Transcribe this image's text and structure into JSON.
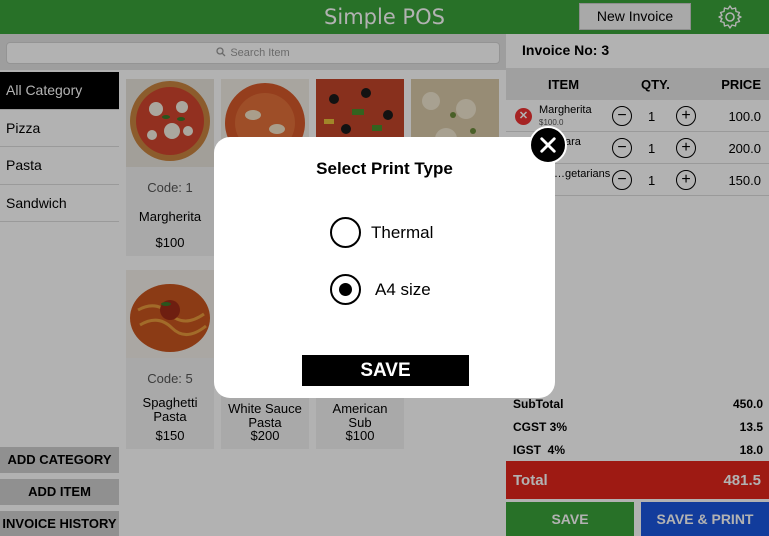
{
  "header": {
    "app_title": "Simple POS",
    "new_invoice_label": "New Invoice",
    "brand_color": "#3aa23a"
  },
  "search": {
    "placeholder": "Search Item"
  },
  "categories": [
    {
      "label": "All Category",
      "active": true
    },
    {
      "label": "Pizza"
    },
    {
      "label": "Pasta"
    },
    {
      "label": "Sandwich"
    }
  ],
  "side_actions": {
    "add_category": "ADD CATEGORY",
    "add_item": "ADD ITEM",
    "invoice_history": "INVOICE HISTORY"
  },
  "products": [
    {
      "code": "Code: 1",
      "name": "Margherita",
      "price": "$100",
      "image": "pizza"
    },
    {
      "code": "",
      "name": "",
      "price": "",
      "image": "tomato-pizza"
    },
    {
      "code": "",
      "name": "",
      "price": "",
      "image": "olive-pizza"
    },
    {
      "code": "",
      "name": "",
      "price": "",
      "image": "veg-pizza"
    },
    {
      "code": "Code: 5",
      "name": "Spaghetti Pasta",
      "price": "$150",
      "image": "spaghetti"
    },
    {
      "code": "",
      "name": "White Sauce Pasta",
      "price": "$200",
      "image": ""
    },
    {
      "code": "",
      "name": "American Sub",
      "price": "$100",
      "image": ""
    }
  ],
  "invoice": {
    "label": "Invoice No:",
    "number": "3",
    "columns": {
      "item": "ITEM",
      "qty": "QTY.",
      "price": "PRICE"
    },
    "items": [
      {
        "name": "Margherita",
        "unit_price": "$100.0",
        "qty": "1",
        "amount": "100.0"
      },
      {
        "name": "…ara",
        "unit_price": "",
        "qty": "1",
        "amount": "200.0"
      },
      {
        "name": "…getarians",
        "unit_price": "",
        "qty": "1",
        "amount": "150.0"
      }
    ],
    "subtotal_label": "SubTotal",
    "subtotal": "450.0",
    "cgst_label": "CGST 3%",
    "cgst": "13.5",
    "igst_label": "IGST  4%",
    "igst": "18.0",
    "total_label": "Total",
    "total": "481.5",
    "save_label": "SAVE",
    "save_print_label": "SAVE & PRINT",
    "total_color": "#e3261c",
    "save_color": "#3aa23a",
    "save_print_color": "#1a56e0"
  },
  "modal": {
    "title": "Select Print Type",
    "options": [
      {
        "label": "Thermal",
        "selected": false
      },
      {
        "label": "A4 size",
        "selected": true
      }
    ],
    "save_label": "SAVE"
  },
  "icons": {
    "settings": "gear-icon",
    "search": "search-icon",
    "close": "close-icon",
    "remove": "remove-icon",
    "decrease": "minus-circle-icon",
    "increase": "plus-circle-icon"
  }
}
